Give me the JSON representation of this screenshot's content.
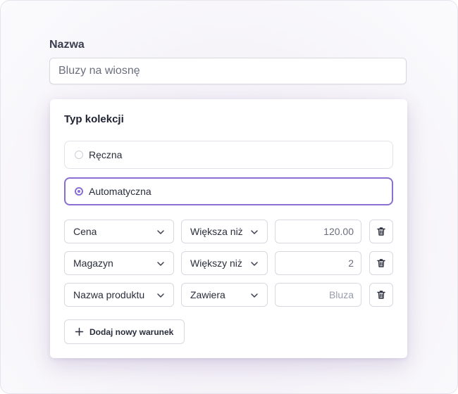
{
  "name_field": {
    "label": "Nazwa",
    "value": "Bluzy na wiosnę"
  },
  "collection_type": {
    "title": "Typ kolekcji",
    "options": [
      {
        "label": "Ręczna",
        "selected": false
      },
      {
        "label": "Automatyczna",
        "selected": true
      }
    ]
  },
  "conditions": [
    {
      "field": "Cena",
      "operator": "Większa niż",
      "value": "120.00",
      "is_placeholder": false
    },
    {
      "field": "Magazyn",
      "operator": "Większy niż",
      "value": "2",
      "is_placeholder": false
    },
    {
      "field": "Nazwa produktu",
      "operator": "Zawiera",
      "value": "Bluza",
      "is_placeholder": true
    }
  ],
  "add_condition_label": "Dodaj nowy warunek",
  "icons": {
    "select": "chevron-down-icon",
    "delete": "trash-icon",
    "add": "plus-icon",
    "radio": "radio-icon"
  },
  "colors": {
    "accent": "#8a6fd0",
    "border": "#d9d8e0",
    "text": "#2a2d3b"
  }
}
